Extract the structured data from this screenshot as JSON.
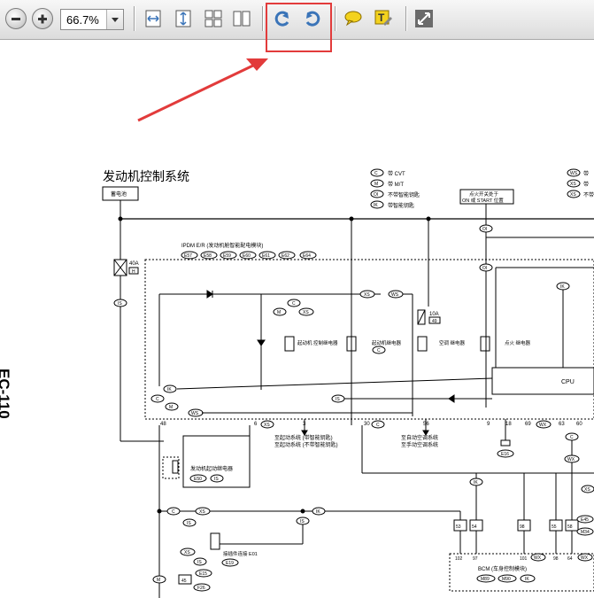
{
  "toolbar": {
    "zoom_out_label": "",
    "zoom_in_label": "",
    "zoom_value": "66.7%",
    "icons": [
      "zoom-out-icon",
      "zoom-in-icon",
      "fit-width-icon",
      "fit-page-icon",
      "two-page-continuous-icon",
      "two-page-icon",
      "rotate-counterclockwise-icon",
      "rotate-clockwise-icon",
      "comment-icon",
      "text-annotation-icon",
      "fullscreen-icon"
    ]
  },
  "document": {
    "side_label": "EC-110",
    "title": "发动机控制系统",
    "battery": "蓄电池",
    "legend_left": [
      {
        "code": "C",
        "text": "带 CVT"
      },
      {
        "code": "M",
        "text": "带 M/T"
      },
      {
        "code": "OI",
        "text": "不带智能钥匙"
      },
      {
        "code": "IK",
        "text": "带智能钥匙"
      }
    ],
    "legend_right_codes": [
      "WS",
      "XS",
      "XS"
    ],
    "legend_right_texts": [
      "带",
      "带",
      "不带"
    ],
    "ignition_note": [
      "点火开关处于",
      "ON 或 START 位置"
    ],
    "ipdm_label": "IPDM E/R (发动机舱智能配电模块)",
    "ipdm_connectors": [
      "E57",
      "E58",
      "E59",
      "E60",
      "E61",
      "E62",
      "E64"
    ],
    "fuse_40a": "40A",
    "fuse_h": "H",
    "fuse_10a": "10A",
    "fuse_49": "49",
    "relays": [
      "起动机 控制继电器",
      "起动机继电器",
      "空调 继电器",
      "点火 继电器"
    ],
    "cpu_label": "CPU",
    "pins": [
      "48",
      "6",
      "3",
      "30",
      "56",
      "9",
      "18",
      "69",
      "63",
      "60",
      "53",
      "54",
      "98",
      "55",
      "58",
      "102",
      "97",
      "101",
      "98",
      "64",
      "45"
    ],
    "connector_codes": [
      "E16",
      "E15",
      "E19",
      "F26",
      "E50",
      "E45",
      "M34"
    ],
    "system_notes": [
      "至起动系统 (带智能钥匙)",
      "至起动系统 (不带智能钥匙)",
      "至自动空调系统",
      "至手动空调系统"
    ],
    "start_cut_relay": "发动机起动继电器",
    "joint_connector": "接插件连接 E01",
    "bcm_label": "BCM (车身控制模块)",
    "bcm_connectors": [
      "M89",
      "M90",
      "IK"
    ],
    "code_labels": [
      "C",
      "M",
      "XS",
      "WS",
      "IK",
      "IS",
      "OI",
      "WX"
    ]
  },
  "colors": {
    "annotation": "#e23b3b",
    "toolbar_bg": "#e6e6e6",
    "icon_blue": "#3a74b8",
    "icon_yellow": "#f3d21e"
  }
}
